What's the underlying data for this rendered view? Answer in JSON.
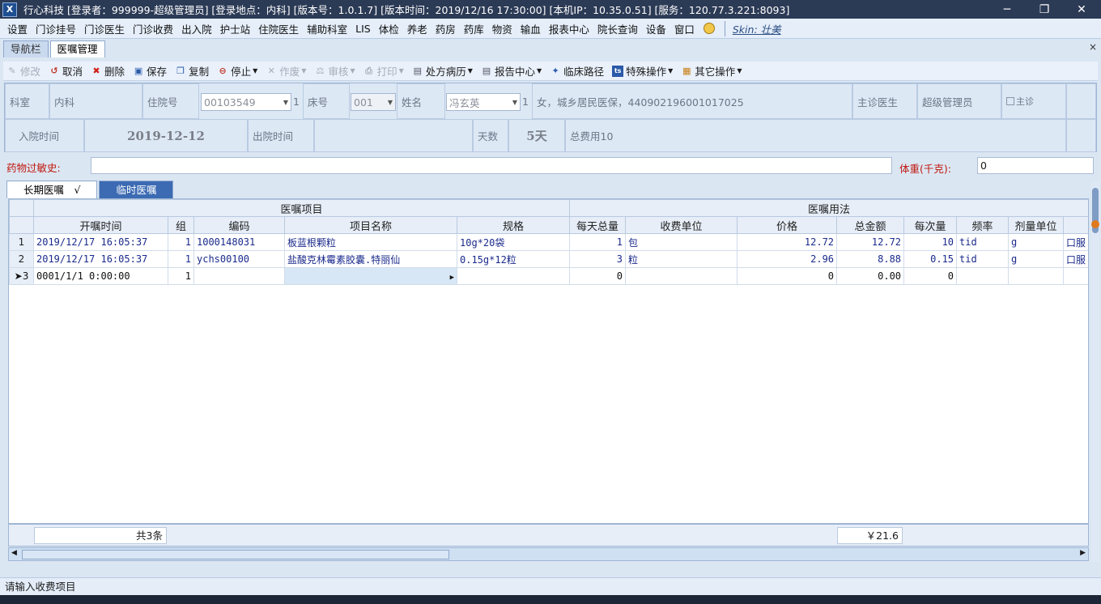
{
  "titlebar": {
    "text": "行心科技  [登录者：999999-超级管理员]  [登录地点：内科]  [版本号：1.0.1.7]  [版本时间：2019/12/16 17:30:00]  [本机IP：10.35.0.51]  [服务：120.77.3.221:8093]",
    "min": "─",
    "max": "❐",
    "close": "✕"
  },
  "menu": [
    "设置",
    "门诊挂号",
    "门诊医生",
    "门诊收费",
    "出入院",
    "护士站",
    "住院医生",
    "辅助科室",
    "LIS",
    "体检",
    "养老",
    "药房",
    "药库",
    "物资",
    "输血",
    "报表中心",
    "院长查询",
    "设备",
    "窗口"
  ],
  "skin_label": "Skin: 壮美",
  "tabs": {
    "nav": "导航栏",
    "orders": "医嘱管理",
    "close": "×"
  },
  "toolbar": {
    "edit": "修改",
    "cancel": "取消",
    "delete": "删除",
    "save": "保存",
    "copy": "复制",
    "stop": "停止",
    "void": "作废",
    "audit": "审核",
    "print": "打印",
    "prescription": "处方病历",
    "report": "报告中心",
    "pathway": "临床路径",
    "special": "特殊操作",
    "other": "其它操作"
  },
  "patient": {
    "dept_label": "科室",
    "dept": "内科",
    "admission_no_label": "住院号",
    "admission_no": "00103549",
    "bed_label": "床号",
    "bed": "001",
    "name_label": "姓名",
    "name": "冯玄英",
    "detail": "女，城乡居民医保，440902196001017025",
    "doctor_label": "主诊医生",
    "doctor": "超级管理员",
    "chief_label": "主诊",
    "admit_label": "入院时间",
    "admit_date": "2019-12-12",
    "discharge_label": "出院时间",
    "discharge_date": "",
    "days_label": "天数",
    "days": "5天",
    "total_fee": "总费用10",
    "one": "1"
  },
  "allergy": {
    "label": "药物过敏史:",
    "value": "",
    "weight_label": "体重(千克):",
    "weight": "0"
  },
  "order_tabs": {
    "long": "长期医嘱　√",
    "temp": "临时医嘱"
  },
  "grid": {
    "group1": "医嘱项目",
    "group2": "医嘱用法",
    "columns": [
      "开嘱时间",
      "组",
      "编码",
      "项目名称",
      "规格",
      "每天总量",
      "收费单位",
      "价格",
      "总金额",
      "每次量",
      "频率",
      "剂量单位",
      ""
    ],
    "rows": [
      {
        "rn": "1",
        "time": "2019/12/17 16:05:37",
        "group": "1",
        "code": "1000148031",
        "name": "板蓝根颗粒",
        "spec": "10g*20袋",
        "daily": "1",
        "unit": "包",
        "price": "12.72",
        "amount": "12.72",
        "per": "10",
        "freq": "tid",
        "dose_unit": "g",
        "route": "口服"
      },
      {
        "rn": "2",
        "time": "2019/12/17 16:05:37",
        "group": "1",
        "code": "ychs00100",
        "name": "盐酸克林霉素胶囊.特丽仙",
        "spec": "0.15g*12粒",
        "daily": "3",
        "unit": "粒",
        "price": "2.96",
        "amount": "8.88",
        "per": "0.15",
        "freq": "tid",
        "dose_unit": "g",
        "route": "口服"
      },
      {
        "rn": "➤3",
        "time": "0001/1/1 0:00:00",
        "group": "1",
        "code": "",
        "name": "",
        "spec": "",
        "daily": "0",
        "unit": "",
        "price": "0",
        "amount": "0.00",
        "per": "0",
        "freq": "",
        "dose_unit": "",
        "route": ""
      }
    ]
  },
  "footer": {
    "count": "共3条",
    "total": "￥21.6"
  },
  "status": "请输入收费项目"
}
